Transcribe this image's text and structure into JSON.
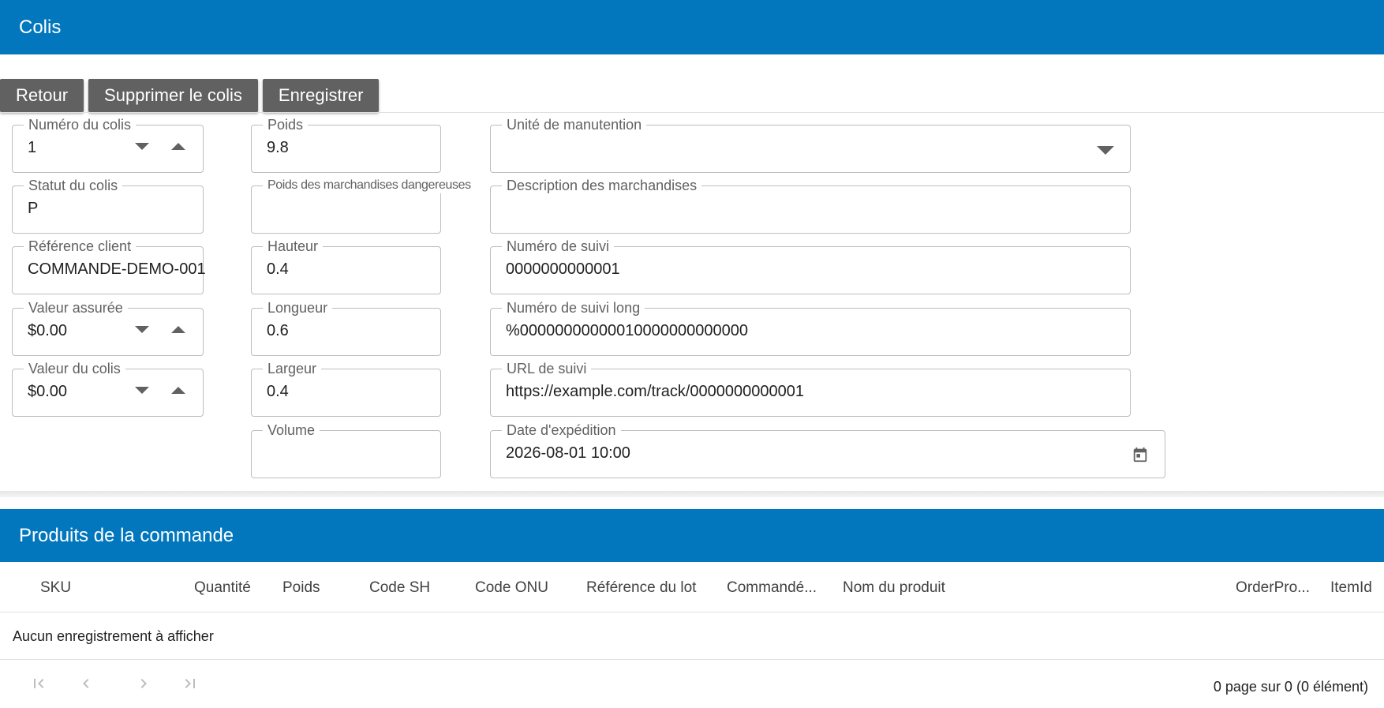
{
  "header": {
    "title": "Colis"
  },
  "toolbar": {
    "back_label": "Retour",
    "delete_label": "Supprimer le colis",
    "save_label": "Enregistrer"
  },
  "form": {
    "package_number": {
      "label": "Numéro du colis",
      "value": "1"
    },
    "package_status": {
      "label": "Statut du colis",
      "value": "P"
    },
    "customer_reference": {
      "label": "Référence client",
      "value": "COMMANDE-DEMO-001"
    },
    "insured_value": {
      "label": "Valeur assurée",
      "value": "$0.00"
    },
    "package_value": {
      "label": "Valeur du colis",
      "value": "$0.00"
    },
    "weight": {
      "label": "Poids",
      "value": "9.8"
    },
    "dangerous_goods_weight": {
      "label": "Poids des marchandises dangereuses",
      "value": ""
    },
    "height": {
      "label": "Hauteur",
      "value": "0.4"
    },
    "length": {
      "label": "Longueur",
      "value": "0.6"
    },
    "width": {
      "label": "Largeur",
      "value": "0.4"
    },
    "volume": {
      "label": "Volume",
      "value": ""
    },
    "handling_unit": {
      "label": "Unité de manutention",
      "value": ""
    },
    "goods_description": {
      "label": "Description des marchandises",
      "value": ""
    },
    "tracking_number": {
      "label": "Numéro de suivi",
      "value": "0000000000001"
    },
    "long_tracking_number": {
      "label": "Numéro de suivi long",
      "value": "%00000000000010000000000000"
    },
    "tracking_url": {
      "label": "URL de suivi",
      "value": "https://example.com/track/0000000000001"
    },
    "ship_date": {
      "label": "Date d'expédition",
      "value": "2026-08-01 10:00"
    }
  },
  "products": {
    "title": "Produits de la commande",
    "columns": [
      "SKU",
      "Quantité",
      "Poids",
      "Code SH",
      "Code ONU",
      "Référence du lot",
      "Commandé...",
      "Nom du produit",
      "OrderPro...",
      "ItemId"
    ],
    "empty_message": "Aucun enregistrement à afficher",
    "pager_info": "0 page sur 0 (0 élément)"
  },
  "icons": {
    "spin_down": "caret-down-icon",
    "spin_up": "caret-up-icon",
    "dropdown": "caret-down-icon",
    "calendar": "calendar-icon",
    "first_page": "first-page-icon",
    "prev_page": "chevron-left-icon",
    "next_page": "chevron-right-icon",
    "last_page": "last-page-icon"
  },
  "colors": {
    "header": "#0277bd",
    "button": "#616161"
  }
}
